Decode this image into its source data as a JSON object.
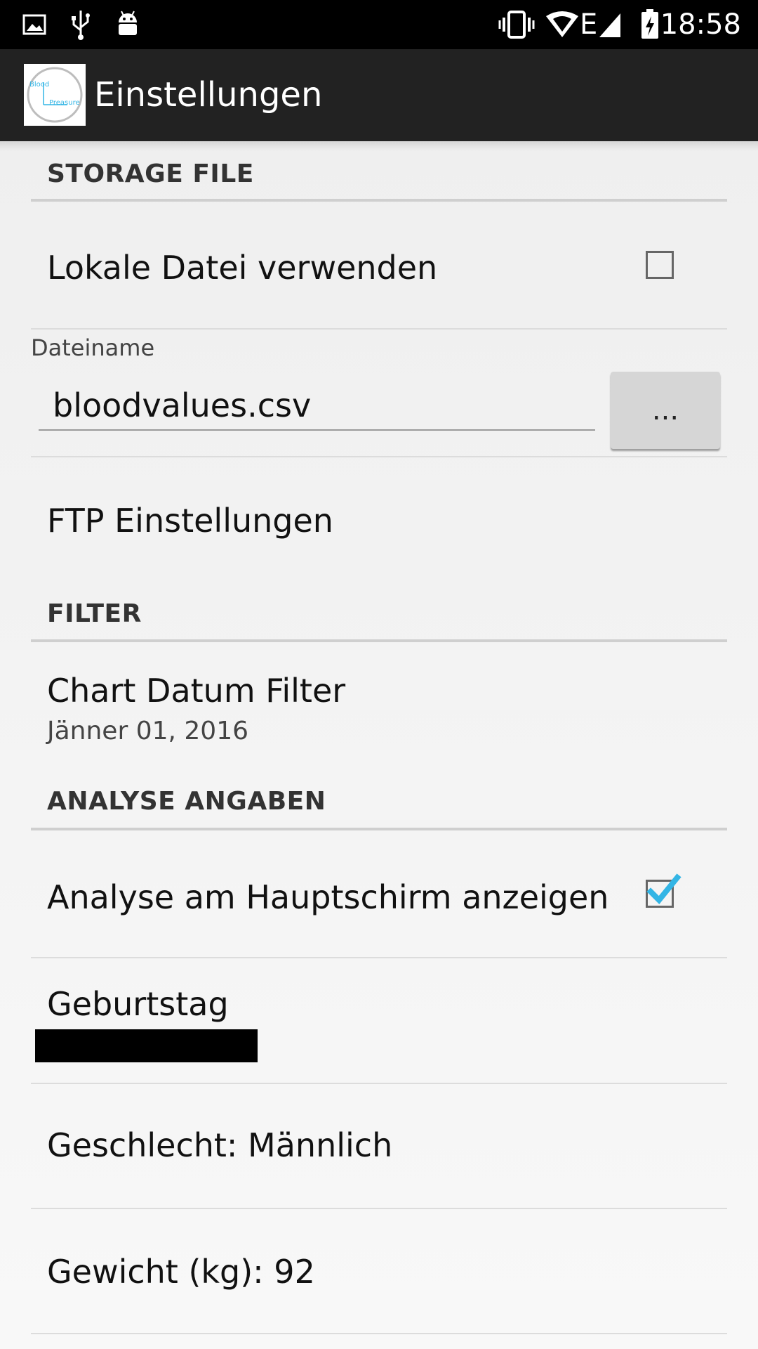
{
  "status_bar": {
    "time": "18:58",
    "network_type": "E",
    "icons": [
      "image-icon",
      "usb-icon",
      "android-icon",
      "vibrate-icon",
      "wifi-icon",
      "signal-icon",
      "battery-charging-icon"
    ]
  },
  "action_bar": {
    "app_icon_text_line1": "Blood",
    "app_icon_text_line2": "Preasure",
    "title": "Einstellungen"
  },
  "sections": {
    "storage": {
      "header": "STORAGE FILE",
      "use_local_file": {
        "label": "Lokale Datei verwenden",
        "checked": false
      },
      "filename": {
        "label": "Dateiname",
        "value": "bloodvalues.csv",
        "button_label": "..."
      },
      "ftp": {
        "label": "FTP Einstellungen"
      }
    },
    "filter": {
      "header": "FILTER",
      "chart_date": {
        "label": "Chart Datum Filter",
        "summary": "Jänner 01, 2016"
      }
    },
    "analysis": {
      "header": "ANALYSE ANGABEN",
      "show_on_main": {
        "label": "Analyse am Hauptschirm anzeigen",
        "checked": true
      },
      "birthday": {
        "label": "Geburtstag"
      },
      "gender": {
        "label": "Geschlecht: Männlich"
      },
      "weight": {
        "label": "Gewicht (kg): 92"
      }
    }
  },
  "colors": {
    "accent": "#33b5e5",
    "actionbar": "#222222",
    "statusbar": "#000000"
  }
}
